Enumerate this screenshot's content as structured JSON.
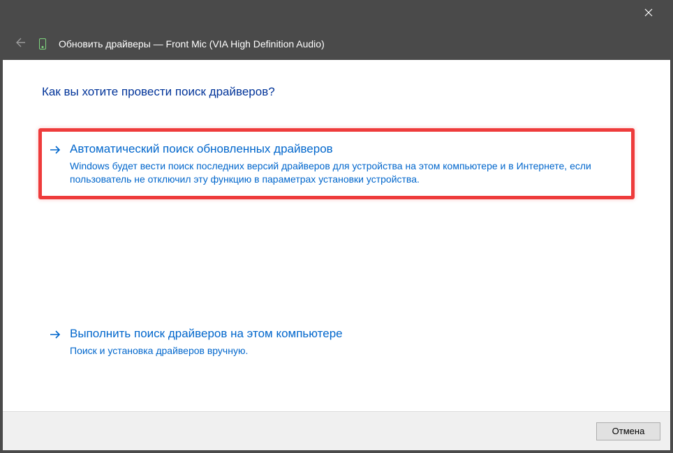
{
  "titlebar": {},
  "header": {
    "title": "Обновить драйверы — Front Mic (VIA High Definition Audio)"
  },
  "main": {
    "question": "Как вы хотите провести поиск драйверов?",
    "options": [
      {
        "title": "Автоматический поиск обновленных драйверов",
        "description": "Windows будет вести поиск последних версий драйверов для устройства на этом компьютере и в Интернете, если пользователь не отключил эту функцию в параметрах установки устройства."
      },
      {
        "title": "Выполнить поиск драйверов на этом компьютере",
        "description": "Поиск и установка драйверов вручную."
      }
    ]
  },
  "footer": {
    "cancel_label": "Отмена"
  },
  "colors": {
    "accent": "#0066cc",
    "highlight_border": "#ee3b3b"
  }
}
